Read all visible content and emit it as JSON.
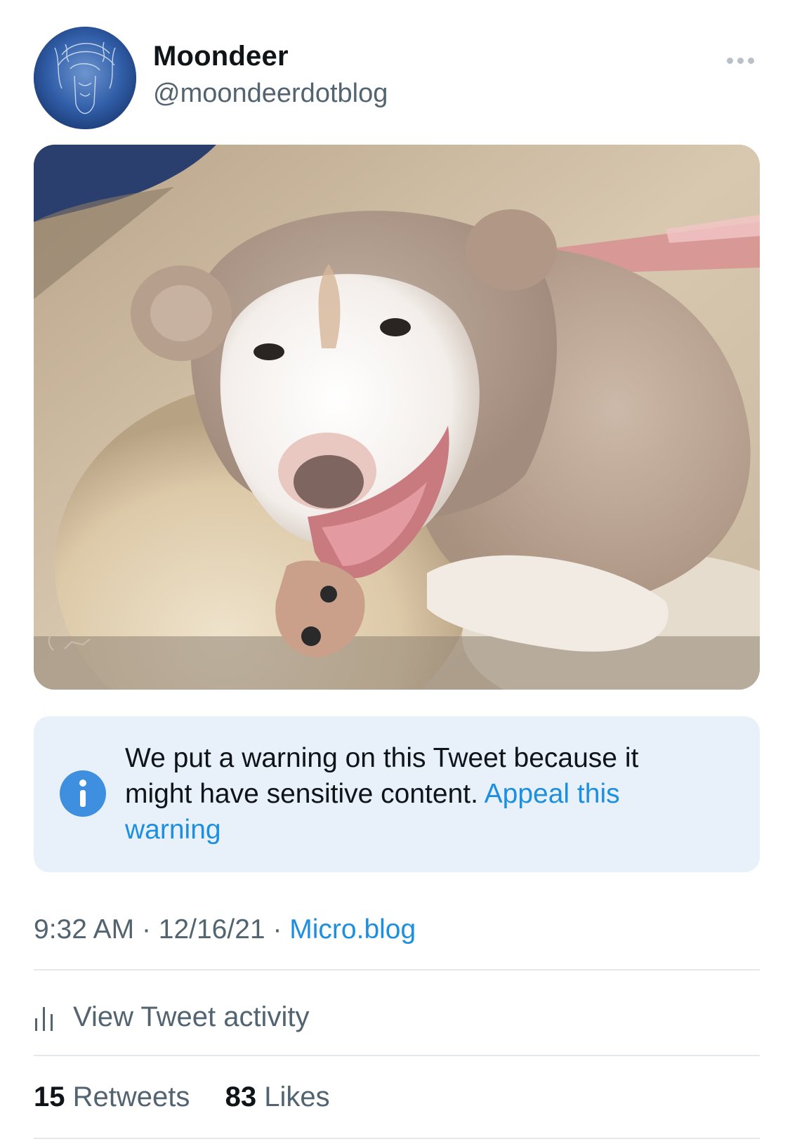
{
  "tweet": {
    "author": {
      "display_name": "Moondeer",
      "handle": "@moondeerdotblog"
    },
    "media": {
      "description_icon": "photo-dog-in-bear-hood"
    },
    "warning": {
      "text": "We put a warning on this Tweet because it might have sensitive content.",
      "link_label": "Appeal this warning"
    },
    "meta": {
      "time": "9:32 AM",
      "separator": "·",
      "date": "12/16/21",
      "source": "Micro.blog"
    },
    "activity": {
      "label": "View Tweet activity"
    },
    "counts": {
      "retweets_count": "15",
      "retweets_label": "Retweets",
      "likes_count": "83",
      "likes_label": "Likes"
    }
  },
  "colors": {
    "accent": "#1d8fe0",
    "secondary_text": "#536471",
    "warning_bg": "#e8f1fa",
    "divider": "#e5e9ec"
  }
}
